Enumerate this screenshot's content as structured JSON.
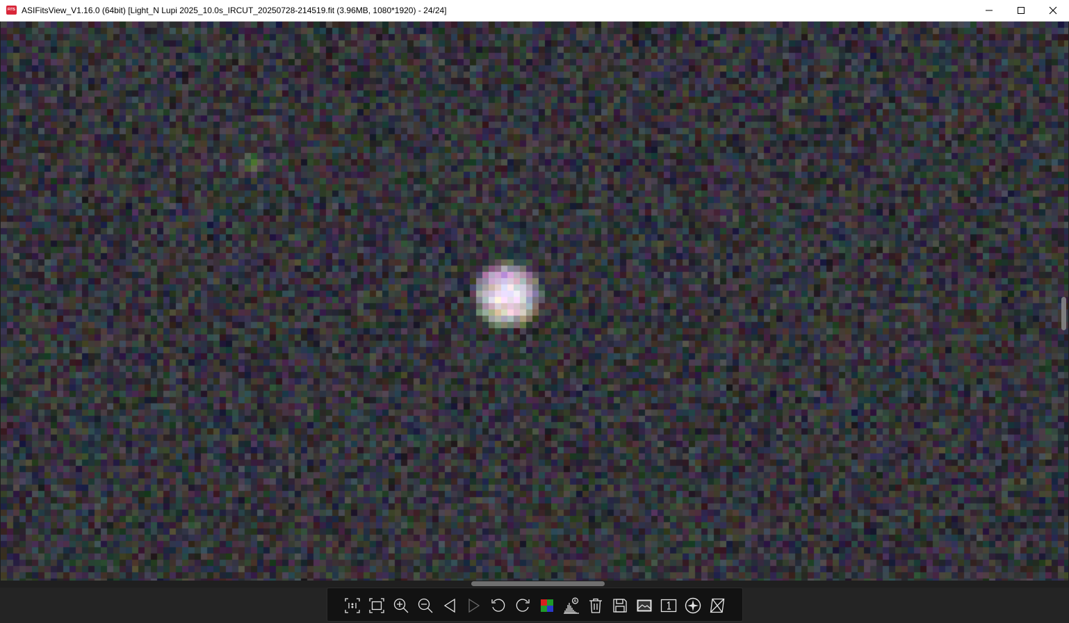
{
  "window": {
    "title": "ASIFitsView_V1.16.0 (64bit) [Light_N Lupi 2025_10.0s_IRCUT_20250728-214519.fit (3.96MB, 1080*1920) - 24/24]",
    "app_icon_text": "FITS"
  },
  "colors": {
    "titlebar_bg": "#ffffff",
    "toolbar_bg": "#121212",
    "icon_color": "#e6e6e6",
    "app_icon": "#d9273a"
  },
  "toolbar": {
    "items": [
      {
        "icon": "actual-size-icon",
        "label": "1:1"
      },
      {
        "icon": "fit-to-window-icon"
      },
      {
        "icon": "zoom-in-icon"
      },
      {
        "icon": "zoom-out-icon"
      },
      {
        "icon": "previous-image-icon"
      },
      {
        "icon": "next-image-icon"
      },
      {
        "icon": "rotate-left-icon"
      },
      {
        "icon": "rotate-right-icon"
      },
      {
        "icon": "debayer-color-icon"
      },
      {
        "icon": "auto-stretch-histogram-icon",
        "label": "A"
      },
      {
        "icon": "delete-icon"
      },
      {
        "icon": "save-icon"
      },
      {
        "icon": "image-view-icon"
      },
      {
        "icon": "single-channel-icon",
        "label": "1"
      },
      {
        "icon": "star-detect-icon"
      },
      {
        "icon": "flip-icon"
      }
    ]
  }
}
